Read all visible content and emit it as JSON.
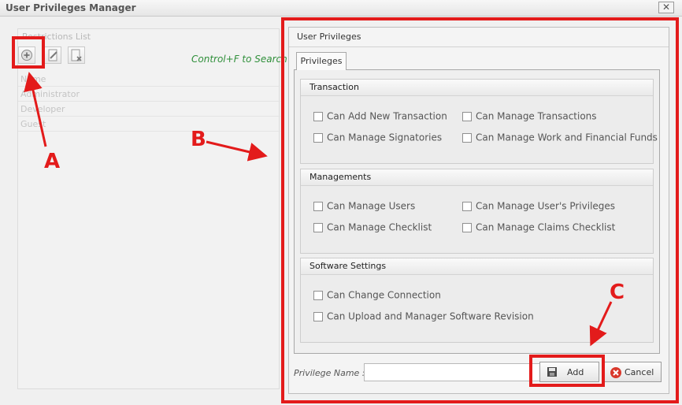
{
  "window": {
    "title": "User Privileges Manager",
    "close_glyph": "✕"
  },
  "left_panel": {
    "title": "Restrictions List",
    "search_hint": "Control+F to Search",
    "column_header": "Name",
    "rows": [
      "Administrator",
      "Developer",
      "Guest"
    ]
  },
  "right_panel": {
    "title": "User Privileges",
    "tab_label": "Privileges",
    "groups": [
      {
        "title": "Transaction",
        "items": [
          "Can Add New Transaction",
          "Can Manage Transactions",
          "Can Manage Signatories",
          "Can Manage Work and Financial Funds"
        ]
      },
      {
        "title": "Managements",
        "items": [
          "Can Manage Users",
          "Can Manage User's Privileges",
          "Can Manage Checklist",
          "Can Manage Claims Checklist"
        ]
      },
      {
        "title": "Software Settings",
        "items": [
          "Can Change Connection",
          "Can Upload and Manager Software Revision"
        ]
      }
    ],
    "privilege_name_label": "Privilege Name :",
    "privilege_name_value": "",
    "add_button": "Add",
    "cancel_button": "Cancel"
  },
  "annotations": {
    "a": "A",
    "b": "B",
    "c": "C"
  },
  "colors": {
    "annotation": "#e31b1b",
    "hint": "#2f8f3a"
  },
  "icons": [
    "add-icon",
    "edit-icon",
    "delete-icon",
    "save-icon",
    "cancel-icon",
    "close-icon"
  ]
}
